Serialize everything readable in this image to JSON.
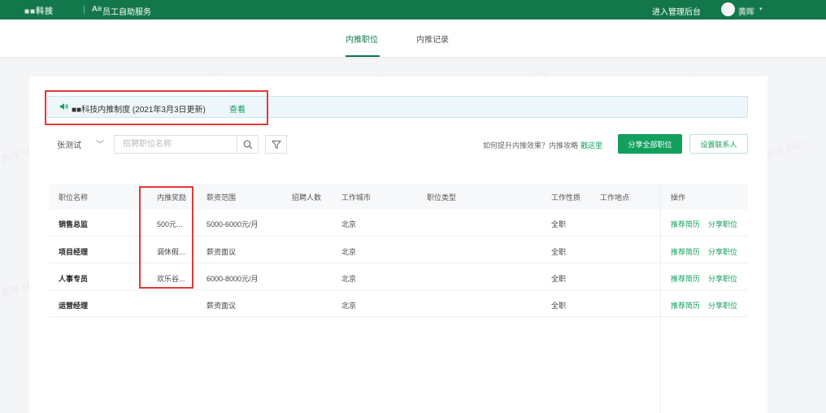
{
  "topbar": {
    "logo": "■■科技",
    "app_icon": "A≡",
    "app_title": "员工自助服务",
    "admin_link": "进入管理后台",
    "user_name": "黄晖",
    "caret": "▾"
  },
  "tabs": [
    {
      "label": "内推职位",
      "active": true
    },
    {
      "label": "内推记录",
      "active": false
    }
  ],
  "notice": {
    "icon": "speaker-icon",
    "text": "■■科技内推制度 (2021年3月3日更新)",
    "link": "查看"
  },
  "filters": {
    "company": "张测试",
    "company_caret": "﹀",
    "search_placeholder": "招聘职位名称"
  },
  "tip": {
    "text": "如何提升内推效果？内推攻略",
    "link": "戳这里"
  },
  "buttons": {
    "share_all": "分享全部职位",
    "set_contact": "设置联系人"
  },
  "table": {
    "headers": [
      "职位名称",
      "内推奖励",
      "薪资范围",
      "招聘人数",
      "工作城市",
      "职位类型",
      "工作性质",
      "工作地点",
      "操作"
    ],
    "rows": [
      {
        "name": "销售总监",
        "reward": "500元...",
        "salary": "5000-6000元/月",
        "count": "",
        "city": "北京",
        "type": "",
        "nature": "全职",
        "location": "",
        "op1": "推荐简历",
        "op2": "分享职位"
      },
      {
        "name": "项目经理",
        "reward": "调休假...",
        "salary": "薪资面议",
        "count": "",
        "city": "北京",
        "type": "",
        "nature": "全职",
        "location": "",
        "op1": "推荐简历",
        "op2": "分享职位"
      },
      {
        "name": "人事专员",
        "reward": "欢乐谷...",
        "salary": "6000-8000元/月",
        "count": "",
        "city": "北京",
        "type": "",
        "nature": "全职",
        "location": "",
        "op1": "推荐简历",
        "op2": "分享职位"
      },
      {
        "name": "运营经理",
        "reward": "",
        "salary": "薪资面议",
        "count": "",
        "city": "北京",
        "type": "",
        "nature": "全职",
        "location": "",
        "op1": "推荐简历",
        "op2": "分享职位"
      }
    ]
  },
  "watermark": "黄晖 6827",
  "colors": {
    "brand": "#12774a",
    "accent": "#12a05f",
    "highlight": "#e53935",
    "notice_bg": "#edf6fa"
  }
}
